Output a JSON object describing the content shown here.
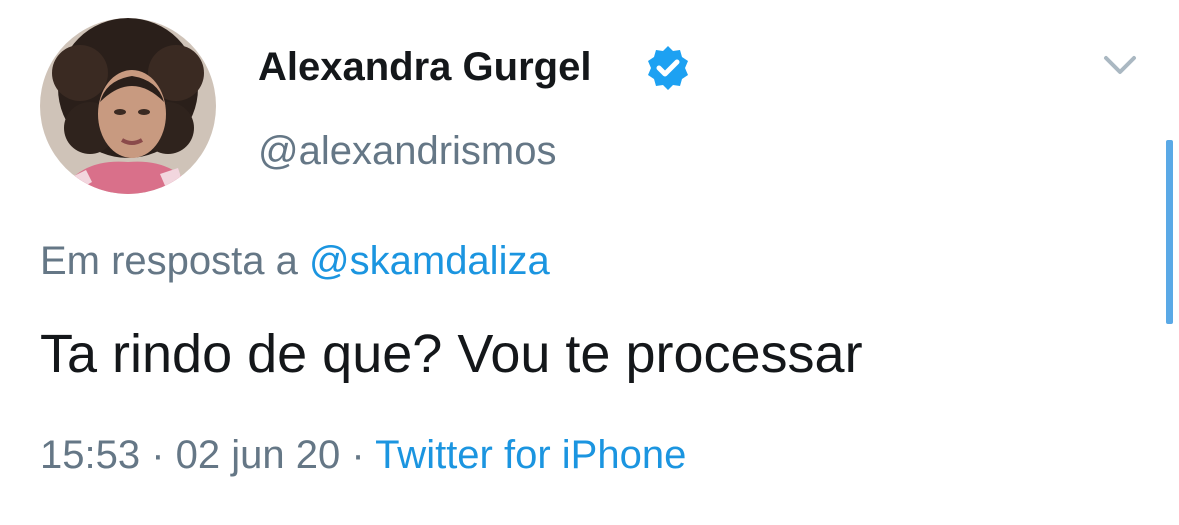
{
  "tweet": {
    "author": {
      "display_name": "Alexandra Gurgel",
      "handle": "@alexandrismos",
      "verified": true
    },
    "reply_context": {
      "prefix": "Em resposta a ",
      "mention": "@skamdaliza"
    },
    "text": "Ta rindo de que? Vou te processar",
    "time": "15:53",
    "separator": " · ",
    "date": "02 jun 20",
    "source": "Twitter for iPhone"
  },
  "colors": {
    "text_primary": "#14171a",
    "text_secondary": "#657786",
    "link": "#1b95e0",
    "verified_badge": "#1da1f2",
    "scroll_indicator": "#5aa9e6"
  },
  "icons": {
    "verified": "verified-badge-icon",
    "menu": "chevron-down-icon"
  }
}
